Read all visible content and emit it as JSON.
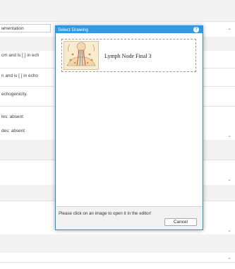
{
  "background": {
    "select_value": "umentation",
    "rows": [
      "cm and is [ ] in ech",
      "n and is [ ] in echo",
      "echogenicity.",
      "les:  absent",
      "des:  absent"
    ]
  },
  "dialog": {
    "title": "Select Drawing",
    "help_icon": "?",
    "drawings": [
      {
        "name": "Lymph Node Final 3"
      }
    ],
    "hint": "Please click on an image to open it in the editor!",
    "cancel_label": "Cancel"
  },
  "colors": {
    "title_bar": "#3399e0",
    "dialog_border": "#2e8fd6",
    "footer": "#f2f2f2"
  }
}
